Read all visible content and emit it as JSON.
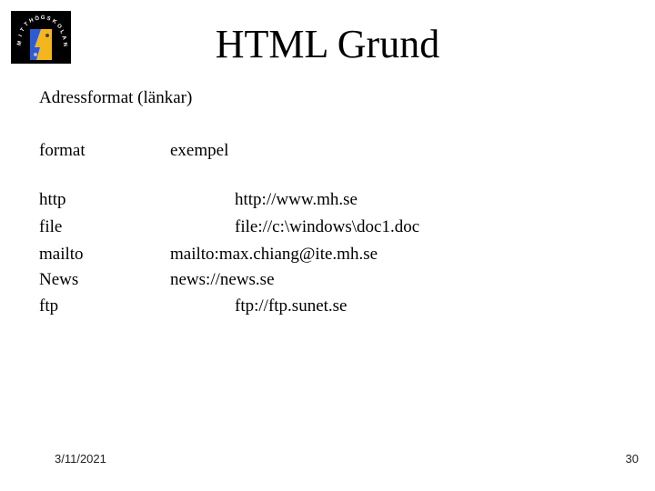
{
  "slide": {
    "title": "HTML Grund",
    "subtitle": "Adressformat (länkar)",
    "logo": {
      "name": "mitthogskolan-logo",
      "text": "MITTHÖGSKOLAN",
      "colors": {
        "background": "#000000",
        "blue": "#2f5bd0",
        "yellow": "#f5b61c"
      }
    },
    "table": {
      "headers": {
        "format": "format",
        "example": "exempel"
      },
      "rows": [
        {
          "format": "http",
          "example": "http://www.mh.se"
        },
        {
          "format": "file",
          "example": "file://c:\\windows\\doc1.doc"
        },
        {
          "format": "mailto",
          "example": "mailto:max.chiang@ite.mh.se"
        },
        {
          "format": "News",
          "example": "news://news.se"
        },
        {
          "format": "ftp",
          "example": "ftp://ftp.sunet.se"
        }
      ]
    },
    "footer": {
      "date": "3/11/2021",
      "page": "30"
    }
  }
}
